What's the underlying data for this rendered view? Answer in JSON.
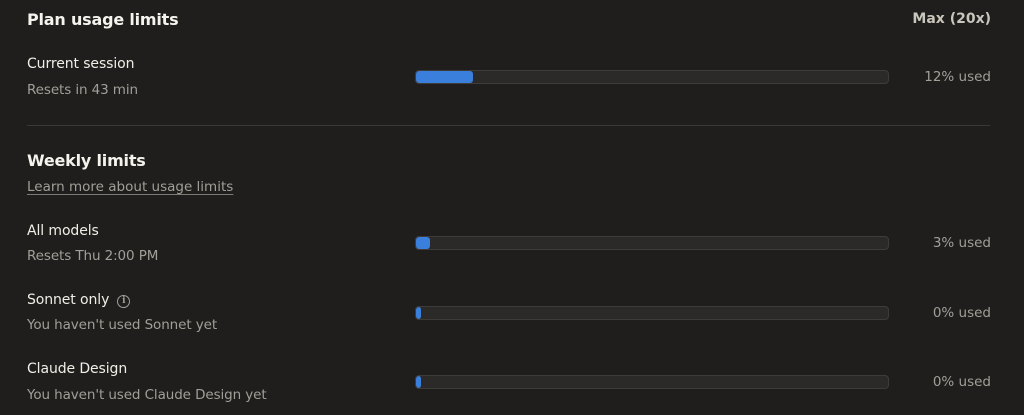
{
  "header": {
    "title": "Plan usage limits",
    "plan": "Max (20x)"
  },
  "session": {
    "label": "Current session",
    "sub": "Resets in 43 min",
    "progress_percent": 12,
    "used_text": "12% used"
  },
  "weekly": {
    "title": "Weekly limits",
    "learn_more": "Learn more about usage limits",
    "rows": [
      {
        "label": "All models",
        "sub": "Resets Thu 2:00 PM",
        "progress_percent": 3,
        "used_text": "3% used",
        "info_icon": false
      },
      {
        "label": "Sonnet only",
        "sub": "You haven't used Sonnet yet",
        "progress_percent": 0,
        "used_text": "0% used",
        "info_icon": true,
        "icon_name": "info-icon"
      },
      {
        "label": "Claude Design",
        "sub": "You haven't used Claude Design yet",
        "progress_percent": 0,
        "used_text": "0% used",
        "info_icon": false
      }
    ]
  },
  "colors": {
    "background": "#1f1e1d",
    "bar_fill": "#3a7fdc",
    "bar_track": "#2b2a28"
  }
}
